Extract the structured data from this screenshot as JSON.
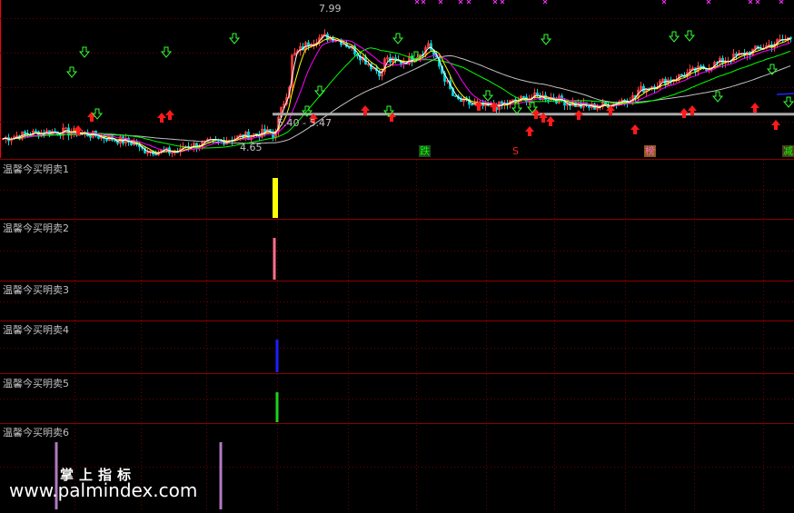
{
  "chart_data": [
    {
      "type": "candlestick",
      "name": "main-price-panel",
      "ylim": [
        4.4,
        8.1
      ],
      "price_labels": {
        "high": "7.99",
        "low": "4.65",
        "range": "5.40 - 5.47"
      },
      "support_level": 5.45,
      "buy_arrow_x": [
        86,
        101,
        178,
        187,
        345,
        402,
        431,
        527,
        544,
        583,
        590,
        598,
        606,
        637,
        672,
        699,
        753,
        762,
        831,
        854
      ],
      "sell_arrow_x": [
        79,
        93,
        107,
        183,
        258,
        338,
        352,
        428,
        438,
        458,
        537,
        569,
        586,
        601,
        742,
        759,
        790,
        850,
        868
      ],
      "top_x_marks_x": [
        459,
        466,
        485,
        507,
        516,
        545,
        553,
        600,
        731,
        780,
        826,
        834,
        860
      ],
      "ma_colors": {
        "ma5": "#ffffff",
        "ma10": "#ffff00",
        "ma20": "#ff00ff",
        "ma60": "#00ff00",
        "ma120": "#c0c0c0"
      },
      "tags": [
        {
          "text": "跌",
          "color": "#00ff00",
          "bg": "#1e4d1e"
        },
        {
          "text": "S",
          "color": "#ff2020",
          "bg": "#000000"
        },
        {
          "text": "榜",
          "color": "#ff66cc",
          "bg": "#8a5a1a"
        },
        {
          "text": "减",
          "color": "#00ff00",
          "bg": "#4d3a1a"
        }
      ]
    },
    {
      "type": "bar",
      "name": "温馨今买明卖1",
      "title": "温馨今买明卖1",
      "bars": [
        {
          "x": 303,
          "color": "#ffff00",
          "width": 6
        }
      ]
    },
    {
      "type": "bar",
      "name": "温馨今买明卖2",
      "title": "温馨今买明卖2",
      "bars": [
        {
          "x": 302,
          "color": "#ff6f8a",
          "width": 3
        }
      ]
    },
    {
      "type": "bar",
      "name": "温馨今买明卖3",
      "title": "温馨今买明卖3",
      "bars": []
    },
    {
      "type": "bar",
      "name": "温馨今买明卖4",
      "title": "温馨今买明卖4",
      "bars": [
        {
          "x": 305,
          "color": "#1e1eff",
          "width": 3
        }
      ]
    },
    {
      "type": "bar",
      "name": "温馨今买明卖5",
      "title": "温馨今买明卖5",
      "bars": [
        {
          "x": 305,
          "color": "#1fd11f",
          "width": 3
        }
      ]
    },
    {
      "type": "bar",
      "name": "温馨今买明卖6",
      "title": "温馨今买明卖6",
      "bars": [
        {
          "x": 62,
          "color": "#b07ac0",
          "width": 3
        },
        {
          "x": 243,
          "color": "#b07ac0",
          "width": 3
        }
      ]
    }
  ],
  "watermark": {
    "cn": "掌上指标",
    "url": "www.palmindex.com"
  }
}
